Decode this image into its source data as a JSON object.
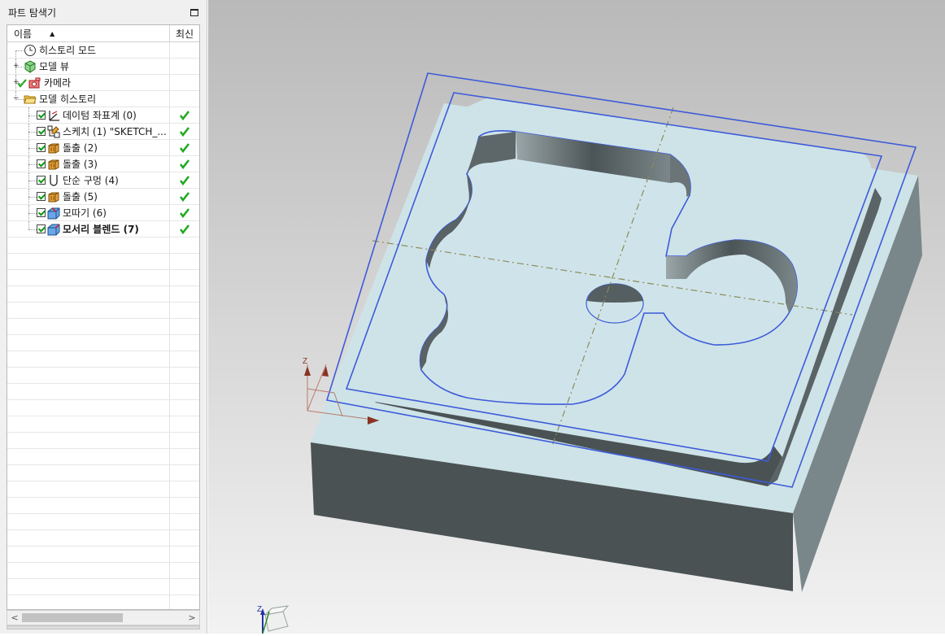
{
  "navigator": {
    "title": "파트 탐색기",
    "columns": {
      "name": "이름",
      "latest": "최신"
    },
    "items": [
      {
        "label": "히스토리 모드",
        "level": 0,
        "icon": "clock-icon",
        "expander": "",
        "checked": false,
        "latest": false,
        "bold": false
      },
      {
        "label": "모델 뷰",
        "level": 0,
        "icon": "model-views-icon",
        "expander": "+",
        "checked": false,
        "latest": false,
        "bold": false
      },
      {
        "label": "카메라",
        "level": 0,
        "icon": "camera-icon",
        "expander": "+",
        "checked": false,
        "latest": false,
        "bold": false,
        "greenTick": true
      },
      {
        "label": "모델 히스토리",
        "level": 0,
        "icon": "folder-open-icon",
        "expander": "−",
        "checked": false,
        "latest": false,
        "bold": false
      },
      {
        "label": "데이텀 좌표계 (0)",
        "level": 1,
        "icon": "datum-csys-icon",
        "checked": true,
        "latest": true,
        "bold": false
      },
      {
        "label": "스케치 (1) \"SKETCH_...",
        "level": 1,
        "icon": "sketch-icon",
        "checked": true,
        "latest": true,
        "bold": false
      },
      {
        "label": "돌출 (2)",
        "level": 1,
        "icon": "extrude-icon",
        "checked": true,
        "latest": true,
        "bold": false
      },
      {
        "label": "돌출 (3)",
        "level": 1,
        "icon": "extrude-icon",
        "checked": true,
        "latest": true,
        "bold": false
      },
      {
        "label": "단순 구멍 (4)",
        "level": 1,
        "icon": "hole-icon",
        "checked": true,
        "latest": true,
        "bold": false
      },
      {
        "label": "돌출 (5)",
        "level": 1,
        "icon": "extrude-icon",
        "checked": true,
        "latest": true,
        "bold": false
      },
      {
        "label": "모따기 (6)",
        "level": 1,
        "icon": "chamfer-icon",
        "checked": true,
        "latest": true,
        "bold": false
      },
      {
        "label": "모서리 블렌드 (7)",
        "level": 1,
        "icon": "edge-blend-icon",
        "checked": true,
        "latest": true,
        "bold": true
      }
    ],
    "emptyRows": 23
  },
  "viewport": {
    "bgTop": "#b9b9b9",
    "bgBottom": "#f2f2f2",
    "faceTop": "#cde3e8",
    "faceSide": "#4a5254",
    "faceSideLight": "#7a878a",
    "selection": "#3d5bd9",
    "triadZ": "Z"
  },
  "colors": {
    "check": "#22aa22"
  }
}
